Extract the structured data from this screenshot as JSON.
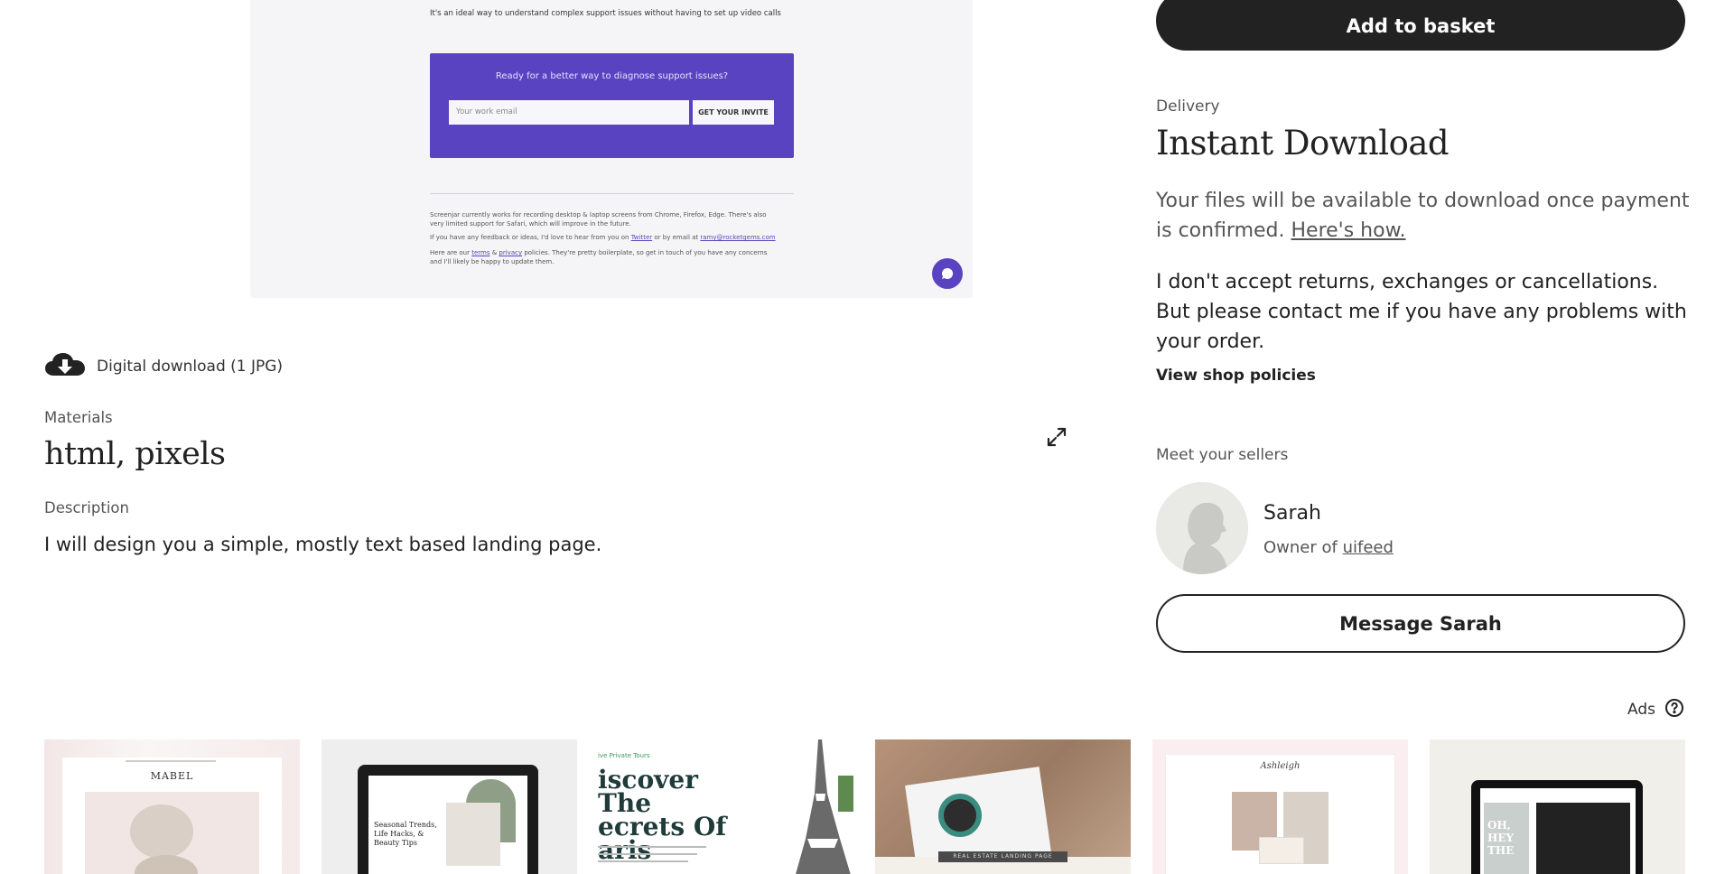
{
  "preview": {
    "intro": "It's an ideal way to understand complex support issues without having to set up video calls",
    "cta_title": "Ready for a better way to diagnose support issues?",
    "email_placeholder": "Your work email",
    "cta_button": "GET YOUR INVITE",
    "footer_line1": "Screenjar currently works for recording desktop & laptop screens from Chrome, Firefox, Edge. There's also",
    "footer_line2": "very limited support for Safari, which will improve in the future.",
    "footer_line3_a": "If you have any feedback or ideas, I'd love to hear from you on ",
    "footer_twitter": "Twitter",
    "footer_line3_b": " or by email at ",
    "footer_email": "ramy@rocketgems.com",
    "footer_line4_a": "Here are our ",
    "footer_terms": "terms",
    "footer_amp": " & ",
    "footer_privacy": "privacy",
    "footer_line4_b": " policies. They're pretty boilerplate, so get in touch of you have any concerns",
    "footer_line5": "and I'll likely be happy to update them."
  },
  "product": {
    "download_label": "Digital download (1 JPG)",
    "materials_label": "Materials",
    "materials_value": "html, pixels",
    "description_label": "Description",
    "description_text": "I will design you a simple, mostly text based landing page."
  },
  "purchase": {
    "add_to_basket": "Add to basket",
    "delivery_label": "Delivery",
    "delivery_title": "Instant Download",
    "files_text": "Your files will be available to download once payment is confirmed. ",
    "heres_how": "Here's how.",
    "returns_text": "I don't accept returns, exchanges or cancellations. But please contact me if you have any problems with your order.",
    "view_policies": "View shop policies"
  },
  "seller": {
    "section_label": "Meet your sellers",
    "name": "Sarah",
    "owner_prefix": "Owner of ",
    "shop": "uifeed",
    "message_button": "Message Sarah"
  },
  "ads": {
    "label": "Ads",
    "items": [
      {
        "title": "MABEL"
      },
      {
        "title": "Seasonal Trends, Life Hacks, & Beauty Tips"
      },
      {
        "title": "iscover The ecrets Of aris",
        "kicker": "ive Private Tours"
      },
      {
        "banner": "REAL ESTATE LANDING PAGE"
      },
      {
        "title": "Ashleigh"
      },
      {
        "title": "OH, HEY THE"
      }
    ]
  },
  "colors": {
    "primary_button": "#222222",
    "preview_accent": "#5a43c1"
  }
}
